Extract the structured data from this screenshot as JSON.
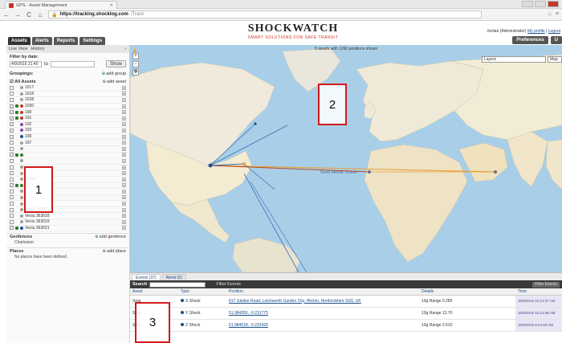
{
  "browser": {
    "tab_title": "GPS - Asset Management",
    "url_host": "https://tracking.shocklog.com",
    "url_path": "/Track"
  },
  "app": {
    "brand": "SHOCKWATCH",
    "tagline": "SMART SOLUTIONS FOR SAFE TRANSIT",
    "user": "Jordan (Administrator)",
    "my_profile": "My profile",
    "logout": "Logout",
    "nav_tabs": [
      "Assets",
      "Alerts",
      "Reports",
      "Settings"
    ],
    "preferences": "Preferences",
    "header_right_btn": "U"
  },
  "left": {
    "live_view": "Live View",
    "history": "History",
    "filter_label": "Filter by date:",
    "filter_value": "4/9/2015 21:40",
    "filter_to": "to",
    "show_btn": "Show",
    "groupings": "Groupings:",
    "add_group": "add group",
    "all_assets": "All Assets",
    "add_asset": "add asset",
    "assets": [
      {
        "name": "1017",
        "checked": false,
        "color": "",
        "dot": "#9e9e9e"
      },
      {
        "name": "1018",
        "checked": false,
        "color": "",
        "dot": "#9e9e9e"
      },
      {
        "name": "1028",
        "checked": false,
        "color": "",
        "dot": "#9e9e9e"
      },
      {
        "name": "1030",
        "checked": true,
        "color": "#2e7d32",
        "dot": "#c0392b"
      },
      {
        "name": "190",
        "checked": true,
        "color": "#2e7d32",
        "dot": "#c0392b"
      },
      {
        "name": "191",
        "checked": true,
        "color": "#2e7d32",
        "dot": "#c0392b"
      },
      {
        "name": "192",
        "checked": true,
        "color": "",
        "dot": "#8e44ad"
      },
      {
        "name": "193",
        "checked": true,
        "color": "",
        "dot": "#8e44ad"
      },
      {
        "name": "199",
        "checked": true,
        "color": "",
        "dot": "#1a4f8b"
      },
      {
        "name": "197",
        "checked": false,
        "color": "",
        "dot": "#9e9e9e"
      },
      {
        "name": "",
        "checked": false,
        "color": "",
        "dot": "#9e9e9e"
      },
      {
        "name": "",
        "checked": true,
        "color": "#2e7d32",
        "dot": "#2e7d32"
      },
      {
        "name": "",
        "checked": false,
        "color": "",
        "dot": "#9e9e9e"
      },
      {
        "name": "",
        "checked": false,
        "color": "",
        "dot": "#9e9e9e"
      },
      {
        "name": "",
        "checked": false,
        "color": "",
        "dot": "#9e9e9e"
      },
      {
        "name": "mma1",
        "checked": false,
        "color": "",
        "dot": "#9e9e9e"
      },
      {
        "name": "X1",
        "checked": true,
        "color": "#2e7d32",
        "dot": "#2e7d32"
      },
      {
        "name": "",
        "checked": false,
        "color": "",
        "dot": "#9e9e9e"
      },
      {
        "name": "",
        "checked": false,
        "color": "",
        "dot": "#9e9e9e"
      },
      {
        "name": "",
        "checked": false,
        "color": "",
        "dot": "#9e9e9e"
      },
      {
        "name": "Vectu 363017",
        "checked": false,
        "color": "",
        "dot": "#9e9e9e"
      },
      {
        "name": "Vectu 363018",
        "checked": false,
        "color": "",
        "dot": "#9e9e9e"
      },
      {
        "name": "Vectu 363019",
        "checked": false,
        "color": "",
        "dot": "#9e9e9e"
      },
      {
        "name": "Vectu 363021",
        "checked": true,
        "color": "#2e7d32",
        "dot": "#1a4f8b"
      }
    ],
    "geofences": "Geofences",
    "add_geofence": "add geofence",
    "geofence_item": "Charleston",
    "places": "Places",
    "add_place": "add place",
    "places_empty": "No places have been defined."
  },
  "map": {
    "info": "0 assets with 1260 positions shown",
    "layers": "Layers",
    "map_type": "Map",
    "ocean_label": "North Atlantic Ocean"
  },
  "events": {
    "tab_events": "Events (37)",
    "tab_alerts": "Alerts (0)",
    "search_label": "Search",
    "filter_label": "Filter Events",
    "filter_btn": "Filter Events",
    "columns": [
      "Asset",
      "Type",
      "Position",
      "Details",
      "Time"
    ],
    "rows": [
      {
        "asset": "Sma",
        "type": "X Shock",
        "position": "617 Jubilee Road, Letchworth Garden City, Hitchin, Hertfordshire SG6, UK",
        "details": "10g Range 0.285",
        "time": "10/8/2015 10:13:37 AM"
      },
      {
        "asset": "Sma",
        "type": "Y Shock",
        "position": "51.984355, -0.231775",
        "details": "10g Range 13.70",
        "time": "10/8/2015 10:13:36 AM"
      },
      {
        "asset": "Sma",
        "type": "Z Shock",
        "position": "51.984618, -0.232420",
        "details": "10g Range 2.610",
        "time": "10/8/2015 9:44:20 AM"
      }
    ]
  },
  "annotations": [
    "1",
    "2",
    "3"
  ]
}
